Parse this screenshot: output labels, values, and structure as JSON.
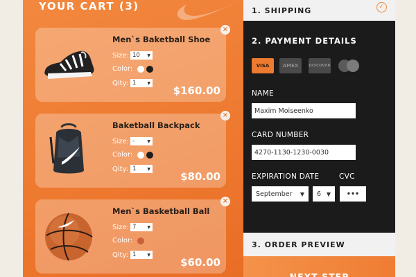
{
  "cart": {
    "title": "YOUR CART (3)",
    "size_label": "Size:",
    "color_label": "Color:",
    "qty_label": "Qity:",
    "items": [
      {
        "name": "Men`s Baketball Shoe",
        "size": "10",
        "colors": [
          "#ffffff",
          "#1e1e1e"
        ],
        "qty": "1",
        "price": "$160.00"
      },
      {
        "name": "Baketball Backpack",
        "size": "-",
        "colors": [
          "#ffffff",
          "#1e1e1e"
        ],
        "qty": "1",
        "price": "$80.00"
      },
      {
        "name": "Men`s Basketball Ball",
        "size": "7",
        "colors": [
          "#c9603b"
        ],
        "qty": "1",
        "price": "$60.00"
      }
    ]
  },
  "checkout": {
    "shipping_title": "1. SHIPPING",
    "payment_title": "2. PAYMENT DETAILS",
    "card_brands": [
      "VISA",
      "AMEX",
      "DISCOVER",
      "MASTERCARD"
    ],
    "name_label": "NAME",
    "name_value": "Maxim Moiseenko",
    "card_label": "CARD NUMBER",
    "card_value": "4270-1130-1230-0030",
    "exp_label": "EXPIRATION DATE",
    "cvc_label": "CVC",
    "exp_month": "September",
    "exp_year": "6",
    "cvc_value": "•••",
    "order_title": "3. ORDER PREVIEW",
    "next_label": "NEXT STEP"
  },
  "colors": {
    "accent": "#ee7a30",
    "dark_panel": "#1b1b1b",
    "background": "#f2ede4"
  }
}
